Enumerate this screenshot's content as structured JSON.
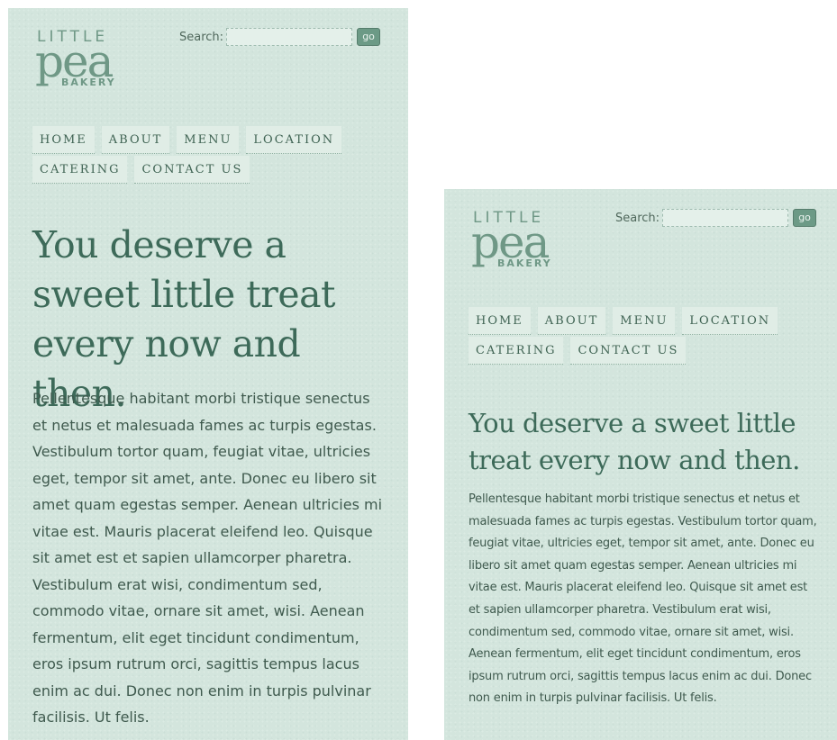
{
  "brand": {
    "line1": "LITTLE",
    "line2": "pea",
    "line3": "BAKERY"
  },
  "search": {
    "label": "Search:",
    "placeholder": "",
    "value": "",
    "button": "go"
  },
  "nav": {
    "items": [
      "HOME",
      "ABOUT",
      "MENU",
      "LOCATION",
      "CATERING",
      "CONTACT US"
    ]
  },
  "hero": {
    "headline": "You deserve a sweet little treat every now and then.",
    "body": "Pellentesque habitant morbi tristique senectus et netus et malesuada fames ac turpis egestas. Vestibulum tortor quam, feugiat vitae, ultricies eget, tempor sit amet, ante. Donec eu libero sit amet quam egestas semper. Aenean ultricies mi vitae est. Mauris placerat eleifend leo. Quisque sit amet est et sapien ullamcorper pharetra. Vestibulum erat wisi, condimentum sed, commodo vitae, ornare sit amet, wisi. Aenean fermentum, elit eget tincidunt condimentum, eros ipsum rutrum orci, sagittis tempus lacus enim ac dui. Donec non enim in turpis pulvinar facilisis. Ut felis."
  },
  "colors": {
    "background": "#d3e5dd",
    "accent": "#6c9a86",
    "headline": "#3d6a59",
    "text": "#3f5a4e"
  }
}
